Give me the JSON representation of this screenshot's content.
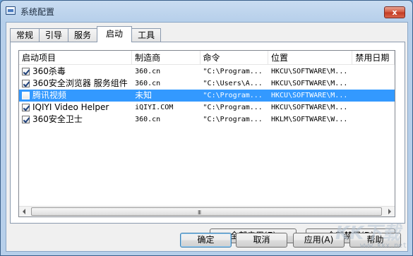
{
  "window": {
    "title": "系统配置",
    "close_label": "x"
  },
  "tabs": [
    {
      "label": "常规"
    },
    {
      "label": "引导"
    },
    {
      "label": "服务"
    },
    {
      "label": "启动"
    },
    {
      "label": "工具"
    }
  ],
  "active_tab": "启动",
  "table": {
    "columns": [
      "启动项目",
      "制造商",
      "命令",
      "位置",
      "禁用日期"
    ],
    "rows": [
      {
        "name": "360杀毒",
        "maker": "360.cn",
        "command": "\"C:\\Program...",
        "location": "HKCU\\SOFTWARE\\M...",
        "checked": true,
        "selected": false
      },
      {
        "name": "360安全浏览器 服务组件",
        "maker": "360.cn",
        "command": "\"C:\\Users\\A...",
        "location": "HKCU\\SOFTWARE\\M...",
        "checked": true,
        "selected": false
      },
      {
        "name": "腾讯视频",
        "maker": "未知",
        "command": "\"C:\\Program...",
        "location": "HKCU\\SOFTWARE\\M...",
        "checked": false,
        "selected": true
      },
      {
        "name": "IQIYI Video Helper",
        "maker": "iQIYI.COM",
        "command": "\"C:\\Program...",
        "location": "HKCU\\SOFTWARE\\M...",
        "checked": true,
        "selected": false
      },
      {
        "name": "360安全卫士",
        "maker": "360.cn",
        "command": "\"C:\\Program...",
        "location": "HKLM\\SOFTWARE\\W...",
        "checked": true,
        "selected": false
      }
    ]
  },
  "scrollbar": {
    "grip": "III"
  },
  "actions": {
    "enable_all": "全部启用(E)",
    "disable_all": "全部禁用(D)"
  },
  "dialog_buttons": {
    "ok": "确定",
    "cancel": "取消",
    "apply": "应用(A)",
    "help": "帮助"
  },
  "watermark": {
    "brand": "KK下载",
    "url": "www.kkx.net"
  }
}
